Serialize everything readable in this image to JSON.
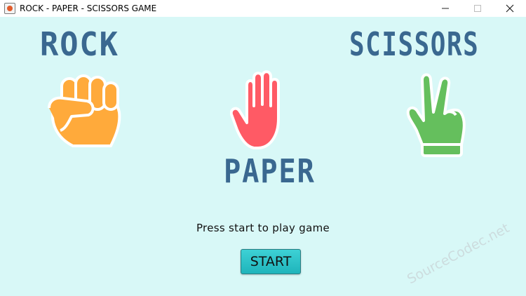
{
  "window": {
    "title": "ROCK - PAPER - SCISSORS GAME",
    "icon": "java-app-icon",
    "controls": [
      "minimize-icon",
      "maximize-icon",
      "close-icon"
    ]
  },
  "labels": {
    "rock": "ROCK",
    "paper": "PAPER",
    "scissors": "SCISSORS"
  },
  "hands": {
    "rock": {
      "icon": "fist-icon",
      "color": "#ffaa3b"
    },
    "paper": {
      "icon": "open-hand-icon",
      "color": "#ff5a65"
    },
    "scissors": {
      "icon": "peace-hand-icon",
      "color": "#65bf5d"
    }
  },
  "prompt": "Press start to play game",
  "start_button": "START",
  "watermark": "SourceCodec.net",
  "colors": {
    "background": "#d8f8f7",
    "label": "#3a6890",
    "button": "#28c2c8"
  }
}
